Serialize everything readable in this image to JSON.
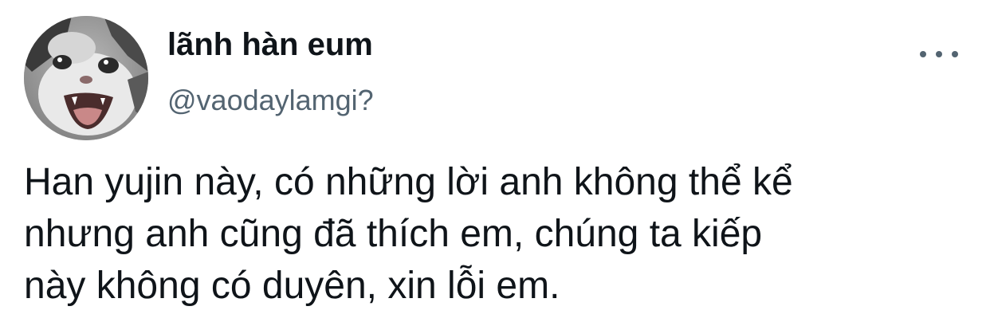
{
  "tweet": {
    "author": {
      "display_name": "lãnh hàn eum",
      "handle": "@vaodaylamgi?"
    },
    "text": "Han yujin này, có những lời anh không thể kể\nnhưng anh cũng đã thích em, chúng ta kiếp\nnày không có duyên, xin lỗi em.",
    "avatar_icon": "crying-cat-avatar",
    "menu_icon": "more-options-icon"
  },
  "colors": {
    "text_primary": "#0f1419",
    "text_secondary": "#536471",
    "background": "#ffffff"
  }
}
